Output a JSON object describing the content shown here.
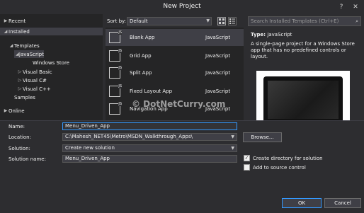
{
  "window": {
    "title": "New Project"
  },
  "left_tree": {
    "recent": "Recent",
    "installed": "Installed",
    "templates": "Templates",
    "javascript": "JavaScript",
    "windows_store": "Windows Store",
    "visual_basic": "Visual Basic",
    "visual_csharp": "Visual C#",
    "visual_cpp": "Visual C++",
    "samples": "Samples",
    "online": "Online"
  },
  "sort": {
    "label": "Sort by:",
    "value": "Default"
  },
  "search": {
    "placeholder": "Search Installed Templates (Ctrl+E)"
  },
  "templates": [
    {
      "name": "Blank App",
      "language": "JavaScript"
    },
    {
      "name": "Grid App",
      "language": "JavaScript"
    },
    {
      "name": "Split App",
      "language": "JavaScript"
    },
    {
      "name": "Fixed Layout App",
      "language": "JavaScript"
    },
    {
      "name": "Navigation App",
      "language": "JavaScript"
    }
  ],
  "details": {
    "type_label": "Type:",
    "type_value": "JavaScript",
    "description": "A single-page project for a Windows Store app that has no predefined controls or layout."
  },
  "watermark": "© DotNetCurry.com",
  "form": {
    "name_label": "Name:",
    "name_value": "Menu_Driven_App",
    "location_label": "Location:",
    "location_value": "C:\\Mahesh_NET45\\Metro\\MSDN_Walkthrough_Apps\\",
    "solution_label": "Solution:",
    "solution_value": "Create new solution",
    "solution_name_label": "Solution name:",
    "solution_name_value": "Menu_Driven_App",
    "browse_label": "Browse...",
    "create_dir_label": "Create directory for solution",
    "source_control_label": "Add to source control",
    "ok_label": "OK",
    "cancel_label": "Cancel"
  },
  "icons": {
    "help": "?",
    "close": "✕",
    "check": "✓"
  }
}
